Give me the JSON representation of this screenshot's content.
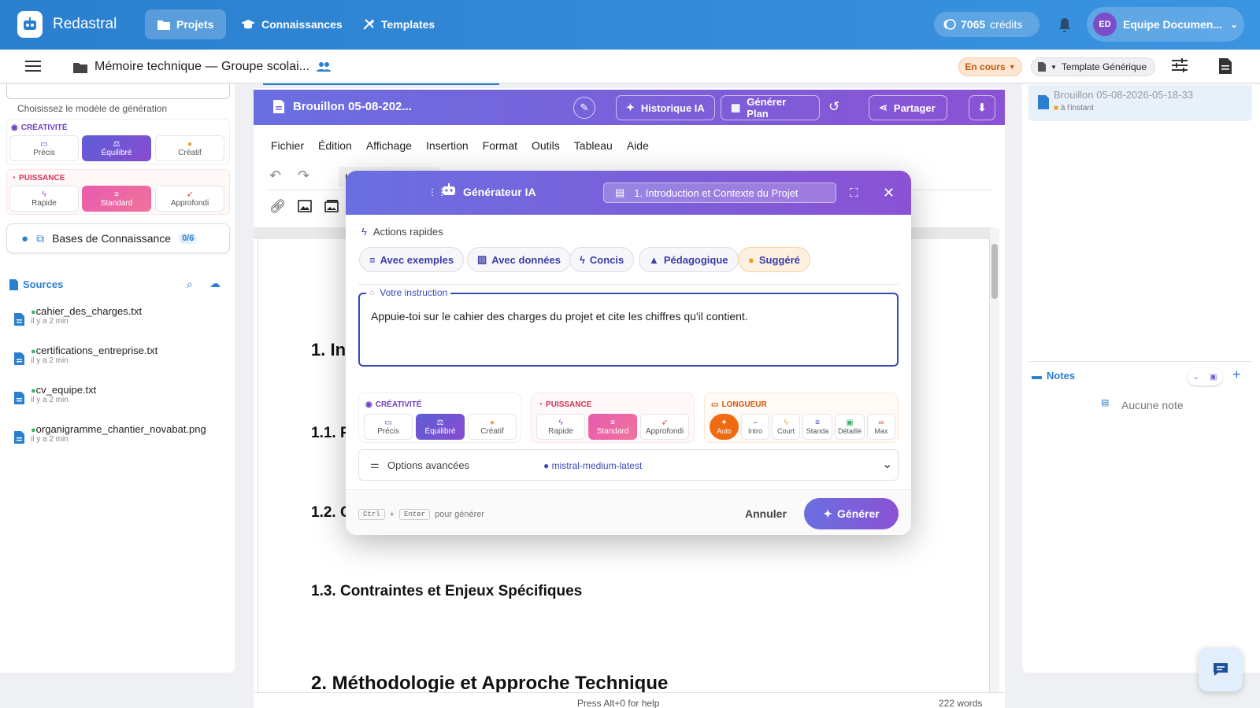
{
  "topbar": {
    "brand": "Redastral",
    "nav": [
      {
        "label": "Projets",
        "icon": "folder-icon",
        "active": true
      },
      {
        "label": "Connaissances",
        "icon": "graduation-cap-icon",
        "active": false
      },
      {
        "label": "Templates",
        "icon": "tools-icon",
        "active": false
      }
    ],
    "credits_value": "7065",
    "credits_label": "crédits",
    "user_initials": "ED",
    "user_name": "Equipe Documen..."
  },
  "subbar": {
    "doc_title": "Mémoire technique — Groupe scolai...",
    "status": "En cours",
    "template": "Template Générique"
  },
  "left_panel": {
    "model_hint": "Choisissez le modèle de génération",
    "creativity_label": "CRÉATIVITÉ",
    "creativity_options": [
      "Précis",
      "Équilibré",
      "Créatif"
    ],
    "power_label": "PUISSANCE",
    "power_options": [
      "Rapide",
      "Standard",
      "Approfondi"
    ],
    "kb_label": "Bases de Connaissance",
    "kb_count": "0/6",
    "sources_label": "Sources",
    "sources": [
      {
        "name": "cahier_des_charges.txt",
        "time": "il y a 2 min"
      },
      {
        "name": "certifications_entreprise.txt",
        "time": "il y a 2 min"
      },
      {
        "name": "cv_equipe.txt",
        "time": "il y a 2 min"
      },
      {
        "name": "organigramme_chantier_novabat.png",
        "time": "il y a 2 min"
      }
    ]
  },
  "editor": {
    "draft_title": "Brouillon 05-08-202...",
    "actions": [
      "Historique IA",
      "Générer Plan",
      "Partager"
    ],
    "menu": [
      "Fichier",
      "Édition",
      "Affichage",
      "Insertion",
      "Format",
      "Outils",
      "Tableau",
      "Aide"
    ],
    "style_select": "H",
    "headings": [
      {
        "text": "1. In",
        "level": 2
      },
      {
        "text": "1.1. P",
        "level": 3
      },
      {
        "text": "1.2. C",
        "level": 3
      },
      {
        "text": "1.3. Contraintes et Enjeux Spécifiques",
        "level": 3
      },
      {
        "text": "2. Méthodologie et Approche Technique",
        "level": 2
      }
    ],
    "footer_help": "Press Alt+0 for help",
    "word_count": "222 words"
  },
  "right_panel": {
    "draft_name": "Brouillon 05-08-2026-05-18-33",
    "draft_time": "à l'instant",
    "notes_label": "Notes",
    "notes_empty": "Aucune note"
  },
  "modal": {
    "title": "Générateur IA",
    "section": "1. Introduction et Contexte du Projet",
    "quick_actions_label": "Actions rapides",
    "quick_actions": [
      {
        "label": "Avec exemples",
        "icon": "list-icon"
      },
      {
        "label": "Avec données",
        "icon": "chart-icon"
      },
      {
        "label": "Concis",
        "icon": "bolt-icon"
      },
      {
        "label": "Pédagogique",
        "icon": "graduation-cap-icon"
      },
      {
        "label": "Suggéré",
        "icon": "bulb-icon"
      }
    ],
    "instruction_label": "Votre instruction",
    "instruction_value": "Appuie-toi sur le cahier des charges du projet et cite les chiffres qu'il contient.",
    "creativity_label": "CRÉATIVITÉ",
    "creativity_options": [
      "Précis",
      "Équilibré",
      "Créatif"
    ],
    "power_label": "PUISSANCE",
    "power_options": [
      "Rapide",
      "Standard",
      "Approfondi"
    ],
    "length_label": "LONGUEUR",
    "length_options": [
      "Auto",
      "Intro",
      "Court",
      "Standa",
      "Détaillé",
      "Max"
    ],
    "advanced_label": "Options avancées",
    "model_name": "mistral-medium-latest",
    "kbd_ctrl": "Ctrl",
    "kbd_plus": "+",
    "kbd_enter": "Enter",
    "kbd_hint": "pour générer",
    "cancel": "Annuler",
    "generate": "Générer"
  },
  "colors": {
    "topbar": "#2a7fcf",
    "accent_purple": "#7a5fd8",
    "pink": "#ec62a6",
    "orange": "#f06a12"
  }
}
